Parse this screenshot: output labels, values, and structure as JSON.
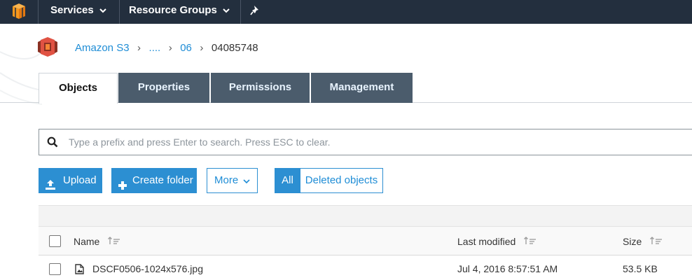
{
  "nav": {
    "services_label": "Services",
    "resource_groups_label": "Resource Groups"
  },
  "breadcrumb": {
    "items": [
      "Amazon S3",
      "....",
      "06"
    ],
    "current": "04085748"
  },
  "tabs": [
    {
      "label": "Objects",
      "active": true
    },
    {
      "label": "Properties",
      "active": false
    },
    {
      "label": "Permissions",
      "active": false
    },
    {
      "label": "Management",
      "active": false
    }
  ],
  "search": {
    "placeholder": "Type a prefix and press Enter to search. Press ESC to clear.",
    "value": ""
  },
  "actions": {
    "upload_label": "Upload",
    "create_folder_label": "Create folder",
    "more_label": "More",
    "filter_all_label": "All",
    "filter_deleted_label": "Deleted objects"
  },
  "table": {
    "columns": {
      "name": "Name",
      "last_modified": "Last modified",
      "size": "Size"
    },
    "rows": [
      {
        "name": "DSCF0506-1024x576.jpg",
        "last_modified": "Jul 4, 2016 8:57:51 AM",
        "size": "53.5 KB",
        "icon": "image-file-icon"
      }
    ]
  },
  "colors": {
    "nav_bg": "#232f3e",
    "accent": "#2c8fd2",
    "tab_inactive_bg": "#4b5c6c",
    "aws_orange": "#f7981d",
    "s3_red": "#e05243"
  }
}
